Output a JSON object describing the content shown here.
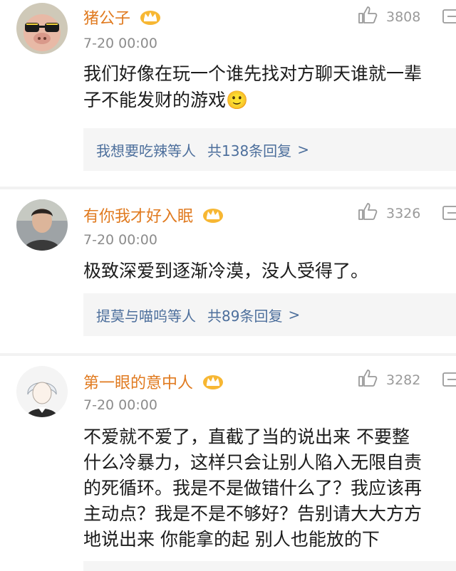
{
  "comments": [
    {
      "username": "猪公子",
      "time": "7-20 00:00",
      "likes": "3808",
      "text_lines": [
        "我们好像在玩一个谁先找对方聊天谁就一辈",
        "子不能发财的游戏🙂"
      ],
      "reply_who": "我想要吃辣等人",
      "reply_count": "共138条回复",
      "reply_chevron": ">"
    },
    {
      "username": "有你我才好入眠",
      "time": "7-20 00:00",
      "likes": "3326",
      "text_lines": [
        "极致深爱到逐渐冷漠，没人受得了。"
      ],
      "reply_who": "提莫与喵呜等人",
      "reply_count": "共89条回复",
      "reply_chevron": ">"
    },
    {
      "username": "第一眼的意中人",
      "time": "7-20 00:00",
      "likes": "3282",
      "text_lines": [
        "不爱就不爱了，直截了当的说出来 不要整",
        "什么冷暴力，这样只会让别人陷入无限自责",
        "的死循环。我是不是做错什么了？我应该再",
        "主动点？我是不是不够好？告别请大大方方",
        "地说出来 你能拿的起 别人也能放的下"
      ]
    }
  ],
  "icons": {
    "vip": "crown-icon",
    "like": "thumbs-up-icon",
    "share": "share-icon"
  },
  "colors": {
    "username": "#e07a1f",
    "meta": "#8c8c8c",
    "reply_link": "#4d6f9c",
    "reply_bg": "#f5f5f5"
  }
}
